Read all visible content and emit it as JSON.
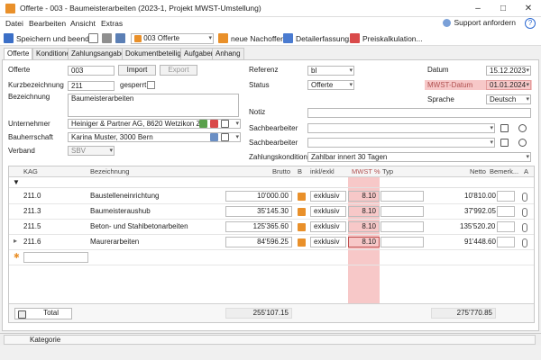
{
  "window": {
    "title": "Offerte - 003 - Baumeisterarbeiten (2023-1, Projekt MWST-Umstellung)",
    "min": "–",
    "max": "□",
    "close": "✕"
  },
  "menu": {
    "items": [
      "Datei",
      "Bearbeiten",
      "Ansicht",
      "Extras"
    ],
    "support": "Support anfordern",
    "help": "?"
  },
  "toolbar": {
    "save_close": "Speichern und beenden",
    "offer_select": "003 Offerte",
    "new_offer": "neue Nachofferte",
    "detail": "Detailerfassung...",
    "price_calc": "Preiskalkulation..."
  },
  "tabs": [
    "Offerte",
    "Konditionen",
    "Zahlungsangaben",
    "Dokumentbeteiligte",
    "Aufgaben",
    "Anhang"
  ],
  "form": {
    "offerte_label": "Offerte",
    "offerte_value": "003",
    "import_btn": "Import",
    "export_btn": "Export",
    "kurz_label": "Kurzbezeichnung",
    "kurz_value": "211",
    "gesperrt_label": "gesperrt",
    "bez_label": "Bezeichnung",
    "bez_value": "Baumeisterarbeiten",
    "unternehmer_label": "Unternehmer",
    "unternehmer_value": "Heiniger & Partner AG, 8620 Wetzikon ZH",
    "bauherr_label": "Bauherrschaft",
    "bauherr_value": "Karina Muster, 3000 Bern",
    "verband_label": "Verband",
    "verband_value": "SBV",
    "referenz_label": "Referenz",
    "referenz_value": "bl",
    "status_label": "Status",
    "status_value": "Offerte",
    "notiz_label": "Notiz",
    "sach1_label": "Sachbearbeiter",
    "sach2_label": "Sachbearbeiter",
    "zahlung_label": "Zahlungskonditionen",
    "zahlung_value": "Zahlbar innert 30 Tagen",
    "datum_label": "Datum",
    "datum_value": "15.12.2023",
    "mwst_datum_label": "MWST-Datum",
    "mwst_datum_value": "01.01.2024",
    "sprache_label": "Sprache",
    "sprache_value": "Deutsch"
  },
  "grid": {
    "headers": {
      "kag": "KAG",
      "bez": "Bezeichnung",
      "brutto": "Brutto",
      "b": "B",
      "inkl": "inkl/exkl",
      "mwst": "MWST %",
      "typ": "Typ",
      "netto": "Netto",
      "bemerk": "Bemerk...",
      "a": "A"
    },
    "rows": [
      {
        "kag": "211.0",
        "bez": "Baustelleneinrichtung",
        "brutto": "10'000.00",
        "inkl": "exklusiv",
        "mwst": "8.10",
        "netto": "10'810.00"
      },
      {
        "kag": "211.3",
        "bez": "Baumeisteraushub",
        "brutto": "35'145.30",
        "inkl": "exklusiv",
        "mwst": "8.10",
        "netto": "37'992.05"
      },
      {
        "kag": "211.5",
        "bez": "Beton- und Stahlbetonarbeiten",
        "brutto": "125'365.60",
        "inkl": "exklusiv",
        "mwst": "8.10",
        "netto": "135'520.20"
      },
      {
        "kag": "211.6",
        "bez": "Maurerarbeiten",
        "brutto": "84'596.25",
        "inkl": "exklusiv",
        "mwst": "8.10",
        "netto": "91'448.60"
      }
    ],
    "total_label": "Total",
    "total_brutto": "255'107.15",
    "total_netto": "275'770.85"
  },
  "status": {
    "kategorie": "Kategorie"
  },
  "colors": {
    "accent": "#2f6bd2",
    "mwst_highlight": "#f7c8c8",
    "orange": "#e9902a"
  }
}
